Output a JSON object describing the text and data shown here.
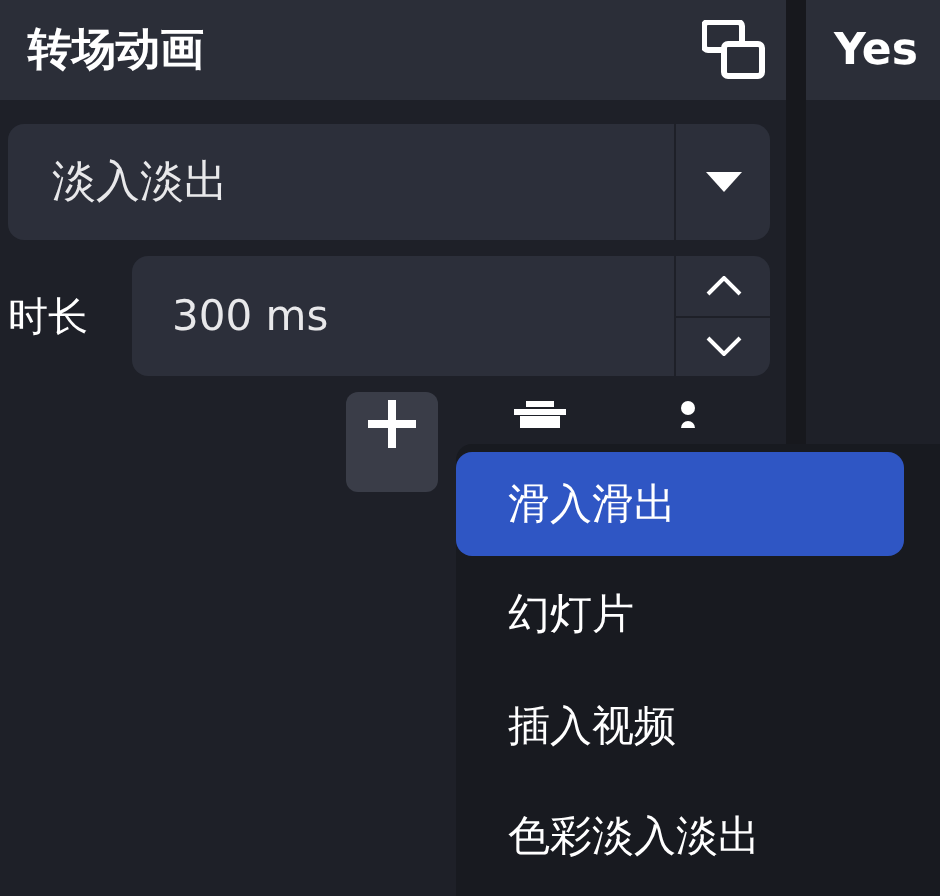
{
  "panel": {
    "title": "转场动画",
    "transition": {
      "value": "淡入淡出"
    },
    "duration": {
      "label": "时长",
      "value": "300 ms"
    }
  },
  "second_panel": {
    "title": "Yes"
  },
  "menu": {
    "items": [
      {
        "label": "滑入滑出",
        "selected": true
      },
      {
        "label": "幻灯片",
        "selected": false
      },
      {
        "label": "插入视频",
        "selected": false
      },
      {
        "label": "色彩淡入淡出",
        "selected": false
      }
    ]
  }
}
